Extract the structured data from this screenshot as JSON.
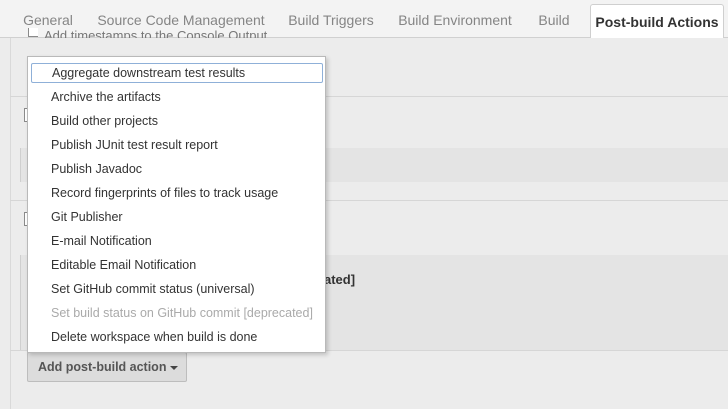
{
  "tabs": [
    {
      "label": "General"
    },
    {
      "label": "Source Code Management"
    },
    {
      "label": "Build Triggers"
    },
    {
      "label": "Build Environment"
    },
    {
      "label": "Build"
    },
    {
      "label": "Post-build Actions",
      "active": true
    }
  ],
  "background": {
    "timestamp_option": "Add timestamps to the Console Output",
    "deprecated_fragment": "ated]"
  },
  "menu": {
    "items": [
      {
        "label": "Aggregate downstream test results",
        "focused": true
      },
      {
        "label": "Archive the artifacts"
      },
      {
        "label": "Build other projects"
      },
      {
        "label": "Publish JUnit test result report"
      },
      {
        "label": "Publish Javadoc"
      },
      {
        "label": "Record fingerprints of files to track usage"
      },
      {
        "label": "Git Publisher"
      },
      {
        "label": "E-mail Notification"
      },
      {
        "label": "Editable Email Notification"
      },
      {
        "label": "Set GitHub commit status (universal)"
      },
      {
        "label": "Set build status on GitHub commit [deprecated]",
        "disabled": true
      },
      {
        "label": "Delete workspace when build is done"
      }
    ]
  },
  "add_button": {
    "label": "Add post-build action"
  },
  "icons": {
    "caret": "caret-down-icon"
  }
}
